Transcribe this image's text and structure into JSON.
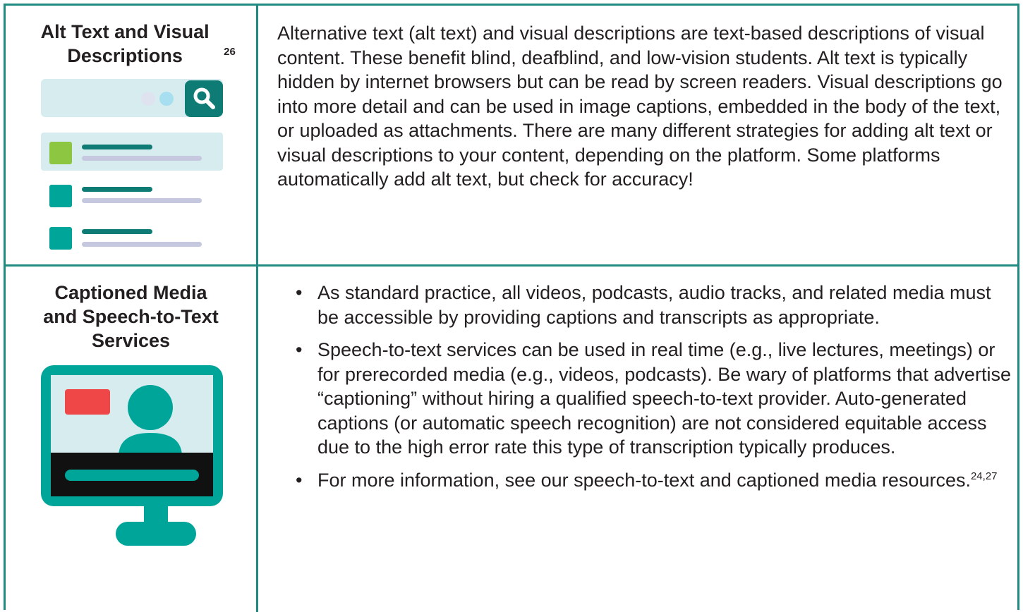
{
  "rows": [
    {
      "label": "Alt Text and Visual Descriptions",
      "label_ref": "26",
      "icon": "search-results-icon",
      "body": "Alternative text (alt text) and visual descriptions are text-based descriptions of visual content. These benefit blind, deafblind, and low-vision students. Alt text is typically hidden by internet browsers but can be read by screen readers. Visual descriptions go into more detail and can be used in image captions, embedded in the body of the text, or uploaded as attachments. There are many different strategies for adding alt text or visual descriptions to your content, depending on the platform. Some platforms automatically add alt text, but check for accuracy!"
    },
    {
      "label_line1": "Captioned Media",
      "label_line2": "and Speech-to-Text",
      "label_line3": "Services",
      "icon": "video-monitor-icon",
      "bullets": [
        "As standard practice, all videos, podcasts, audio tracks, and related media must be accessible by providing captions and transcripts as appropriate.",
        "Speech-to-text services can be used in real time (e.g., live lectures, meetings) or for prerecorded media (e.g., videos, podcasts). Be wary of platforms that advertise “captioning” without hiring a qualified speech-to-text provider. Auto-generated captions (or automatic speech recognition) are not considered equitable access due to the high error rate this type of transcription typically produces.",
        "For more information, see our speech-to-text and captioned media resources."
      ],
      "last_bullet_refs": "24,27",
      "bullet_char": "•"
    }
  ],
  "colors": {
    "border": "#1f8a80",
    "teal": "#00a599",
    "dark_teal": "#0e7c74",
    "light_panel": "#d7ecee",
    "green": "#8dc641",
    "red": "#ef4747",
    "gray_line": "#c5c8de",
    "black": "#111111"
  }
}
